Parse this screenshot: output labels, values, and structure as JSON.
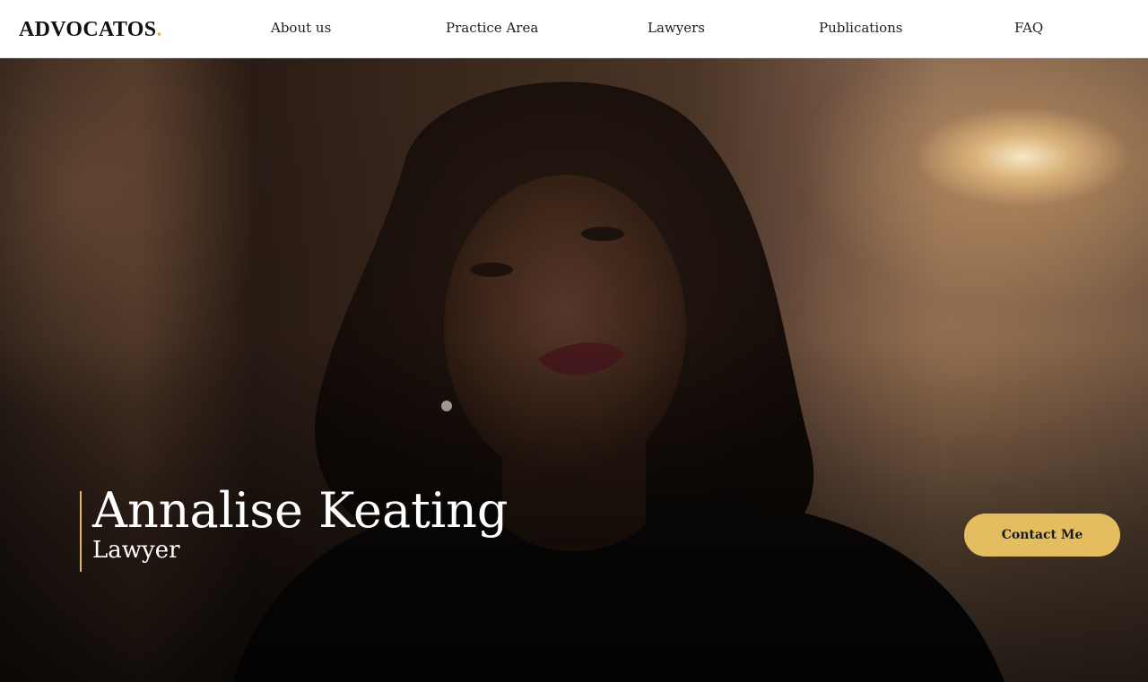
{
  "brand": {
    "name": "ADVOCATOS",
    "dot": ".",
    "accent_color": "#e2b85a"
  },
  "nav": {
    "items": [
      {
        "label": "About us"
      },
      {
        "label": "Practice Area"
      },
      {
        "label": "Lawyers"
      },
      {
        "label": "Publications"
      },
      {
        "label": "FAQ"
      }
    ]
  },
  "hero": {
    "name": "Annalise Keating",
    "role": "Lawyer",
    "cta_label": "Contact Me",
    "cta_color": "#e4bd61"
  }
}
